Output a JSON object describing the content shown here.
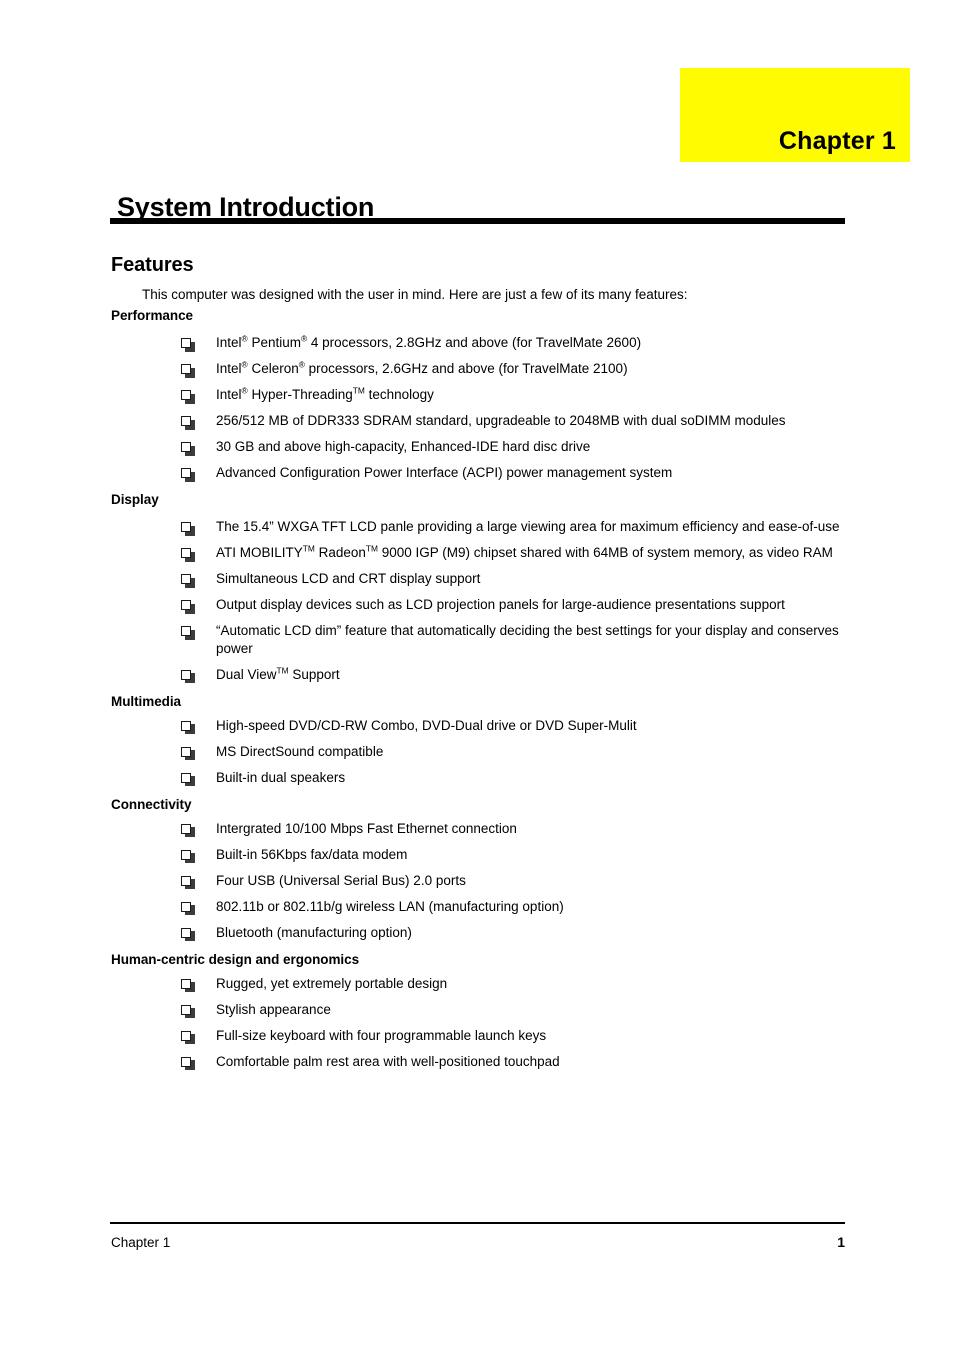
{
  "document": {
    "chapter_tab_label": "Chapter 1",
    "chapter_tab_color": "#fffb00",
    "chapter_title": "System Introduction",
    "section_heading": "Features",
    "intro_paragraph": "This computer was designed with the user in mind. Here are just a few of its many features:"
  },
  "groups": [
    {
      "heading": "Performance",
      "items": [
        {
          "parts": [
            {
              "t": "text",
              "v": "Intel"
            },
            {
              "t": "sup",
              "v": "®"
            },
            {
              "t": "text",
              "v": " Pentium"
            },
            {
              "t": "sup",
              "v": "®"
            },
            {
              "t": "text",
              "v": " 4 processors, 2.8GHz and above (for TravelMate 2600)"
            }
          ],
          "plain": "Intel® Pentium® 4 processors, 2.8GHz and above (for TravelMate 2600)"
        },
        {
          "parts": [
            {
              "t": "text",
              "v": "Intel"
            },
            {
              "t": "sup",
              "v": "®"
            },
            {
              "t": "text",
              "v": " Celeron"
            },
            {
              "t": "sup",
              "v": "®"
            },
            {
              "t": "text",
              "v": " processors, 2.6GHz and above (for TravelMate 2100)"
            }
          ],
          "plain": "Intel® Celeron® processors, 2.6GHz and above (for TravelMate 2100)"
        },
        {
          "parts": [
            {
              "t": "text",
              "v": "Intel"
            },
            {
              "t": "sup",
              "v": "®"
            },
            {
              "t": "text",
              "v": " Hyper-Threading"
            },
            {
              "t": "sup",
              "v": "TM"
            },
            {
              "t": "text",
              "v": " technology"
            }
          ],
          "plain": "Intel® Hyper-ThreadingTM technology"
        },
        {
          "parts": [
            {
              "t": "text",
              "v": "256/512 MB of DDR333 SDRAM standard, upgradeable to 2048MB with dual soDIMM modules"
            }
          ],
          "plain": "256/512 MB of DDR333 SDRAM standard, upgradeable to 2048MB with dual soDIMM modules"
        },
        {
          "parts": [
            {
              "t": "text",
              "v": "30 GB and above high-capacity, Enhanced-IDE hard disc drive"
            }
          ],
          "plain": "30 GB and above high-capacity, Enhanced-IDE hard disc drive"
        },
        {
          "parts": [
            {
              "t": "text",
              "v": "Advanced Configuration Power Interface (ACPI) power management system"
            }
          ],
          "plain": "Advanced Configuration Power Interface (ACPI) power management system"
        }
      ]
    },
    {
      "heading": "Display",
      "items": [
        {
          "parts": [
            {
              "t": "text",
              "v": "The 15.4” WXGA TFT LCD panle providing a large viewing area for maximum efficiency and ease-of-use"
            }
          ],
          "plain": "The 15.4” WXGA TFT LCD panle providing a large viewing area for maximum efficiency and ease-of-use"
        },
        {
          "parts": [
            {
              "t": "text",
              "v": "ATI MOBILITY"
            },
            {
              "t": "sup",
              "v": "TM"
            },
            {
              "t": "text",
              "v": " Radeon"
            },
            {
              "t": "sup",
              "v": "TM"
            },
            {
              "t": "text",
              "v": " 9000 IGP (M9) chipset shared with 64MB of system memory, as video RAM"
            }
          ],
          "plain": "ATI MOBILITYTM RadeonTM 9000 IGP (M9) chipset shared with 64MB of system memory, as video RAM"
        },
        {
          "parts": [
            {
              "t": "text",
              "v": "Simultaneous LCD and CRT display support"
            }
          ],
          "plain": "Simultaneous LCD and CRT display support"
        },
        {
          "parts": [
            {
              "t": "text",
              "v": "Output display devices such as LCD projection panels for large-audience presentations support"
            }
          ],
          "plain": "Output display devices such as LCD projection panels for large-audience presentations support"
        },
        {
          "parts": [
            {
              "t": "text",
              "v": "“Automatic LCD dim” feature that automatically deciding the best settings for your display and conserves power"
            }
          ],
          "plain": "“Automatic LCD dim” feature that automatically deciding the best settings for your display and conserves power"
        },
        {
          "parts": [
            {
              "t": "text",
              "v": "Dual View"
            },
            {
              "t": "sup",
              "v": "TM"
            },
            {
              "t": "text",
              "v": " Support"
            }
          ],
          "plain": "Dual ViewTM Support"
        }
      ]
    },
    {
      "heading": "Multimedia",
      "items": [
        {
          "parts": [
            {
              "t": "text",
              "v": "High-speed DVD/CD-RW Combo, DVD-Dual drive or DVD Super-Mulit"
            }
          ],
          "plain": "High-speed DVD/CD-RW Combo, DVD-Dual drive or DVD Super-Mulit"
        },
        {
          "parts": [
            {
              "t": "text",
              "v": "MS DirectSound compatible"
            }
          ],
          "plain": "MS DirectSound compatible"
        },
        {
          "parts": [
            {
              "t": "text",
              "v": "Built-in dual speakers"
            }
          ],
          "plain": "Built-in dual speakers"
        }
      ]
    },
    {
      "heading": "Connectivity",
      "items": [
        {
          "parts": [
            {
              "t": "text",
              "v": "Intergrated 10/100 Mbps Fast Ethernet connection"
            }
          ],
          "plain": "Intergrated 10/100 Mbps Fast Ethernet connection"
        },
        {
          "parts": [
            {
              "t": "text",
              "v": "Built-in 56Kbps fax/data modem"
            }
          ],
          "plain": "Built-in 56Kbps fax/data modem"
        },
        {
          "parts": [
            {
              "t": "text",
              "v": "Four USB (Universal Serial Bus) 2.0 ports"
            }
          ],
          "plain": "Four USB (Universal Serial Bus) 2.0 ports"
        },
        {
          "parts": [
            {
              "t": "text",
              "v": "802.11b or 802.11b/g wireless LAN (manufacturing option)"
            }
          ],
          "plain": "802.11b or 802.11b/g wireless LAN (manufacturing option)"
        },
        {
          "parts": [
            {
              "t": "text",
              "v": "Bluetooth (manufacturing option)"
            }
          ],
          "plain": "Bluetooth (manufacturing option)"
        }
      ]
    },
    {
      "heading": "Human-centric design and ergonomics",
      "items": [
        {
          "parts": [
            {
              "t": "text",
              "v": "Rugged, yet extremely portable design"
            }
          ],
          "plain": "Rugged, yet extremely portable design"
        },
        {
          "parts": [
            {
              "t": "text",
              "v": "Stylish appearance"
            }
          ],
          "plain": "Stylish appearance"
        },
        {
          "parts": [
            {
              "t": "text",
              "v": "Full-size keyboard with four programmable launch keys"
            }
          ],
          "plain": "Full-size keyboard with four programmable launch keys"
        },
        {
          "parts": [
            {
              "t": "text",
              "v": "Comfortable palm rest area with well-positioned touchpad"
            }
          ],
          "plain": "Comfortable palm rest area with well-positioned touchpad"
        }
      ]
    }
  ],
  "footer": {
    "left_label": "Chapter 1",
    "page_number": "1"
  }
}
